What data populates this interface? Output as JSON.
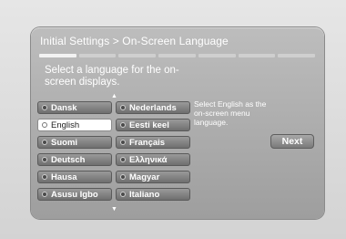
{
  "header": {
    "title": "Initial Settings > On-Screen Language",
    "steps": 7,
    "active_step": 1
  },
  "prompt": "Select a language for the on-screen displays.",
  "languages": {
    "left": [
      "Dansk",
      "English",
      "Suomi",
      "Deutsch",
      "Hausa",
      "Asusu Igbo"
    ],
    "right": [
      "Nederlands",
      "Eesti keel",
      "Français",
      "Ελληνικά",
      "Magyar",
      "Italiano"
    ],
    "selected": "English"
  },
  "help_text": "Select English as  the on-screen menu language.",
  "next_label": "Next",
  "icons": {
    "scroll_up": "scroll-up-arrow-icon",
    "scroll_down": "scroll-down-arrow-icon",
    "radio": "radio-indicator-icon"
  }
}
